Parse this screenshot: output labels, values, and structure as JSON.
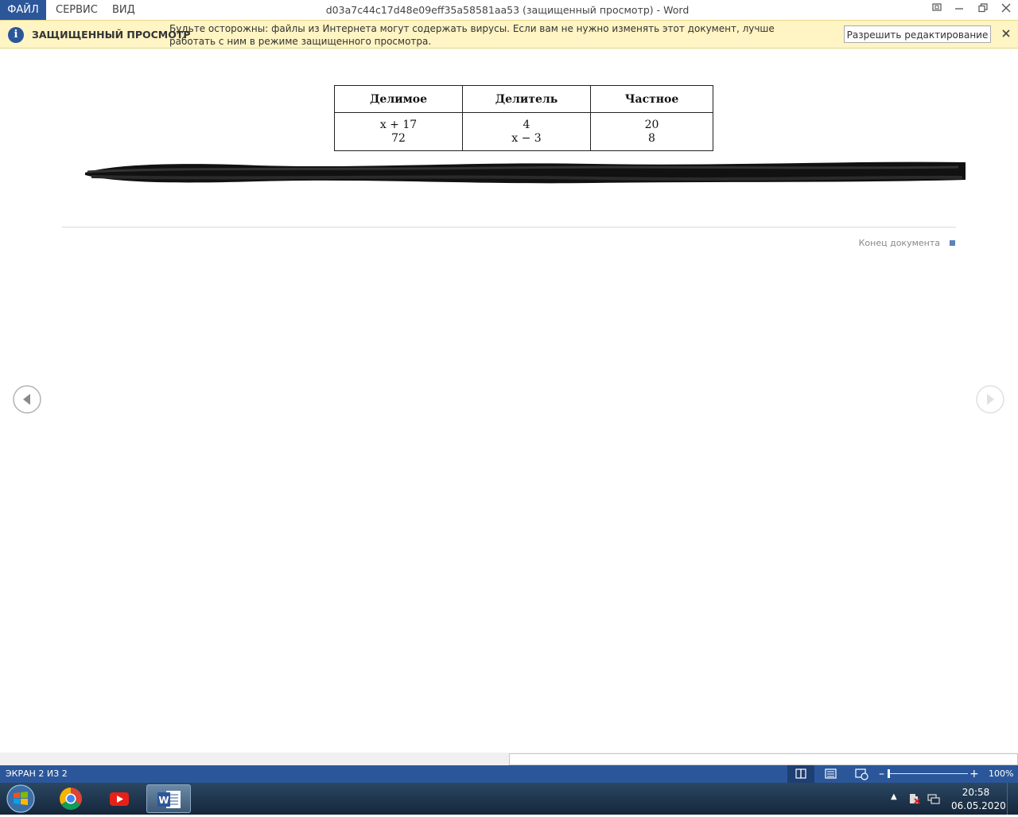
{
  "menu": {
    "file": "ФАЙЛ",
    "service": "СЕРВИС",
    "view": "ВИД"
  },
  "window": {
    "title": "d03a7c44c17d48e09eff35a58581aa53 (защищенный просмотр) - Word"
  },
  "protected_view": {
    "title": "ЗАЩИЩЕННЫЙ ПРОСМОТР",
    "message": "Будьте осторожны: файлы из Интернета могут содержать вирусы. Если вам не нужно изменять этот документ, лучше работать с ним в режиме защищенного просмотра.",
    "enable_button": "Разрешить редактирование"
  },
  "document": {
    "table": {
      "headers": [
        "Делимое",
        "Делитель",
        "Частное"
      ],
      "cells": [
        [
          "x + 17",
          "4",
          "20"
        ],
        [
          "72",
          "x − 3",
          "8"
        ]
      ]
    },
    "end_label": "Конец документа"
  },
  "status": {
    "page": "ЭКРАН 2 ИЗ 2",
    "zoom": "100%",
    "zoom_fraction": 0.0
  },
  "clock": {
    "time": "20:58",
    "date": "06.05.2020"
  },
  "colors": {
    "accent": "#2b579a",
    "protected_bar": "#fff4c3"
  },
  "icons": {
    "info": "info-icon",
    "close": "close-icon",
    "prev": "arrow-left-icon",
    "next": "arrow-right-icon",
    "read_mode": "read-mode-icon",
    "print_layout": "print-layout-icon",
    "web_layout": "web-layout-icon"
  }
}
